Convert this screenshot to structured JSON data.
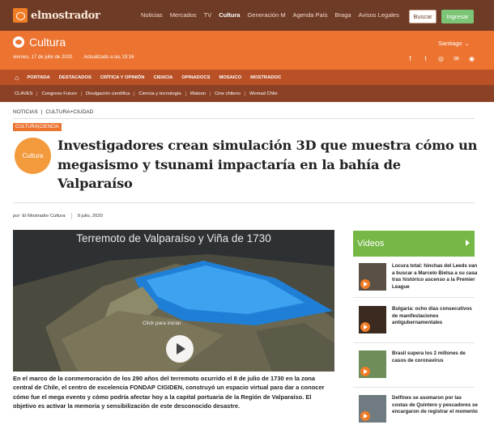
{
  "header": {
    "logo_text": "elmostrador",
    "nav": [
      "Noticias",
      "Mercados",
      "TV",
      "Cultura",
      "Generación M",
      "Agenda País",
      "Braga",
      "Avisos Legales"
    ],
    "active_nav": "Cultura",
    "search_label": "Buscar",
    "login_label": "Ingresar"
  },
  "section": {
    "name": "Cultura",
    "date": "viernes, 17 de julio de 2020",
    "updated": "Actualizado a las 19:16",
    "city": "Santiago",
    "social_icons": [
      "facebook-icon",
      "twitter-icon",
      "instagram-icon",
      "mail-icon",
      "rss-icon"
    ]
  },
  "main_nav": [
    "PORTADA",
    "DESTACADOS",
    "CRÍTICA Y OPINIÓN",
    "CIENCIA",
    "OPINADOCS",
    "MOSAICO",
    "MOSTRADOC"
  ],
  "sub_nav": [
    "CLAVES",
    "Congreso Futuro",
    "Divulgación científica",
    "Ciencia y tecnología",
    "Watson",
    "Cine chileno",
    "Womad Chile"
  ],
  "breadcrumb": {
    "first": "NOTICIAS",
    "separator": "|",
    "second": "CULTURA+CIUDAD"
  },
  "article": {
    "tag": "CULTURA|CIENCIA",
    "badge": "Cultura",
    "headline": "Investigadores crean simulación 3D que muestra cómo un megasismo y tsunami impactaría en la bahía de Valparaíso",
    "by_prefix": "por",
    "author": "El Mostrador Cultura",
    "date": "9 julio, 2020",
    "video_title": "Terremoto de Valparaíso y Viña de 1730",
    "video_hint": "Click para iniciar",
    "lead": "En el marco de la conmemoración de los 290 años del terremoto ocurrido el 8 de julio de 1730 en la zona central de Chile, el centro de excelencia FONDAP CIGIDEN, construyó un espacio virtual para dar a conocer cómo fue el mega evento y cómo podría afectar hoy a la capital portuaria de la Región de Valparaíso. El objetivo es activar la memoria y sensibilización de este desconocido desastre."
  },
  "sidebar": {
    "title": "Videos",
    "items": [
      {
        "text": "Locura total: hinchas del Leeds van a buscar a Marcelo Bielsa a su casa tras histórico ascenso a la Premier League",
        "color": "#5a5046"
      },
      {
        "text": "Bulgaria: ocho días consecutivos de manifestaciones antigubernamentales",
        "color": "#3a2a1f"
      },
      {
        "text": "Brasil supera los 2 millones de casos de coronavirus",
        "color": "#6f8d5a"
      },
      {
        "text": "Delfines se asomaron por las costas de Quintero y pescadores se encargaron de registrar el momento",
        "color": "#6f7b80"
      }
    ]
  }
}
